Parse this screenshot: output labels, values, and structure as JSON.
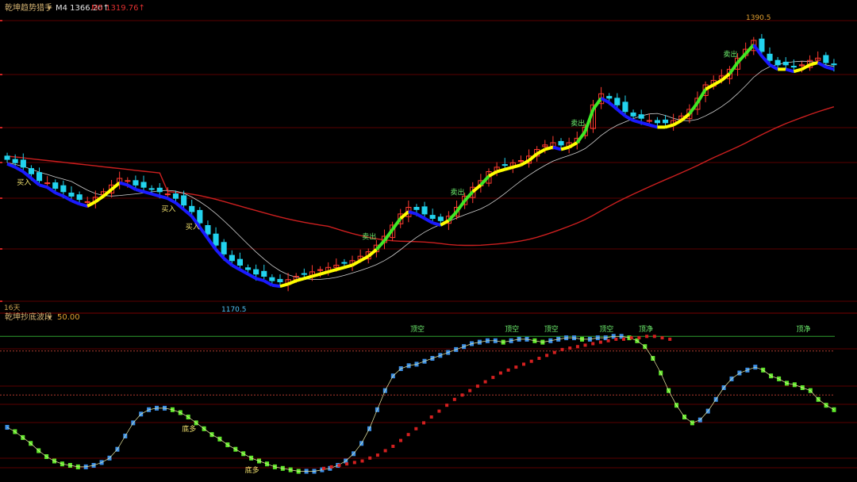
{
  "header": {
    "indicator_name": "乾坤趋势猎手",
    "ma4_label": "M4 1366.20↑",
    "ma5_label": "M5 1319.76↑"
  },
  "main_annotations": {
    "period_label": "16天",
    "low_label": "1170.5",
    "high_label": "1390.5"
  },
  "sub_header": {
    "indicator_name": "乾坤抄底波段",
    "value_label": "50.00"
  },
  "signals": {
    "buy": "买入",
    "sell": "卖出",
    "bottom_long": "底多",
    "top_short": "顶空",
    "top_short_alt": "顶净"
  },
  "colors": {
    "background": "#000000",
    "candle_up": "#ff3b30",
    "candle_down": "#22d3ee",
    "trend_up": "#ffff00",
    "trend_down": "#1a1aff",
    "trend_strong": "#3ee824",
    "long_ma": "#cc1f1f",
    "short_ma": "#d0d0d0",
    "wave_up": "#3b8fe8",
    "wave_down": "#5ee82a",
    "wave_slow": "#d42020",
    "grid": "#5a0000",
    "level_line": "#2e9e2e",
    "dotted_level": "#b03a2e",
    "header_text": "#d0b070",
    "ma5_text": "#e03030",
    "sell_text": "#6ef06e",
    "buy_text": "#f0e06e"
  },
  "chart_data": [
    {
      "type": "candlestick",
      "title": "乾坤趋势猎手",
      "series": [
        {
          "name": "M4",
          "value": 1366.2
        },
        {
          "name": "M5",
          "value": 1319.76
        }
      ],
      "ylim": [
        1150,
        1410
      ],
      "low_value": 1170.5,
      "high_value": 1390.5,
      "close": [
        1281,
        1278,
        1274,
        1268,
        1262,
        1260,
        1255,
        1252,
        1248,
        1245,
        1243,
        1247,
        1252,
        1258,
        1264,
        1262,
        1258,
        1256,
        1254,
        1252,
        1250,
        1246,
        1240,
        1234,
        1224,
        1214,
        1204,
        1196,
        1190,
        1186,
        1182,
        1178,
        1176,
        1172,
        1171,
        1173,
        1176,
        1178,
        1180,
        1182,
        1184,
        1186,
        1188,
        1190,
        1194,
        1198,
        1204,
        1212,
        1222,
        1232,
        1238,
        1236,
        1232,
        1228,
        1226,
        1230,
        1238,
        1248,
        1256,
        1262,
        1270,
        1274,
        1276,
        1278,
        1280,
        1284,
        1290,
        1294,
        1296,
        1294,
        1296,
        1300,
        1310,
        1330,
        1340,
        1336,
        1330,
        1324,
        1320,
        1318,
        1316,
        1314,
        1314,
        1316,
        1320,
        1326,
        1336,
        1348,
        1352,
        1356,
        1362,
        1372,
        1380,
        1388,
        1378,
        1370,
        1366,
        1366,
        1364,
        1366,
        1370,
        1372,
        1368,
        1366
      ],
      "grid": true,
      "legend": "top-left"
    },
    {
      "type": "line",
      "title": "乾坤抄底波段",
      "ylim": [
        0,
        100
      ],
      "value_label": 50.0,
      "levels": [
        95,
        85,
        55
      ],
      "fast_wave": [
        33,
        30,
        26,
        22,
        17,
        13,
        10,
        8,
        7,
        6,
        6,
        7,
        9,
        12,
        18,
        27,
        36,
        42,
        45,
        46,
        46,
        45,
        43,
        40,
        36,
        32,
        28,
        25,
        21,
        18,
        15,
        12,
        10,
        8,
        6,
        5,
        4,
        3,
        3,
        3,
        4,
        5,
        7,
        10,
        15,
        22,
        32,
        45,
        58,
        68,
        73,
        75,
        76,
        78,
        80,
        82,
        84,
        86,
        88,
        90,
        91,
        92,
        92,
        91,
        92,
        93,
        93,
        92,
        91,
        92,
        93,
        94,
        94,
        93,
        93,
        94,
        94,
        95,
        95,
        94,
        92,
        88,
        80,
        70,
        58,
        48,
        40,
        36,
        38,
        44,
        52,
        60,
        66,
        70,
        72,
        74,
        72,
        68,
        66,
        63,
        62,
        60,
        58,
        52,
        48,
        45
      ],
      "slow_wave": [
        4,
        4,
        4,
        4,
        4,
        4,
        4,
        4,
        4,
        4,
        4,
        4,
        4,
        4,
        4,
        4,
        4,
        4,
        4,
        4,
        4,
        4,
        4,
        4,
        4,
        4,
        4,
        4,
        4,
        4,
        4,
        4,
        4,
        4,
        4,
        5,
        6,
        7,
        8,
        9,
        10,
        12,
        14,
        17,
        20,
        24,
        28,
        32,
        36,
        40,
        44,
        48,
        52,
        55,
        58,
        61,
        64,
        67,
        70,
        72,
        74,
        76,
        78,
        80,
        82,
        84,
        86,
        87,
        88,
        89,
        90,
        91,
        92,
        93,
        93,
        94,
        94,
        95,
        95,
        94,
        93
      ]
    }
  ]
}
